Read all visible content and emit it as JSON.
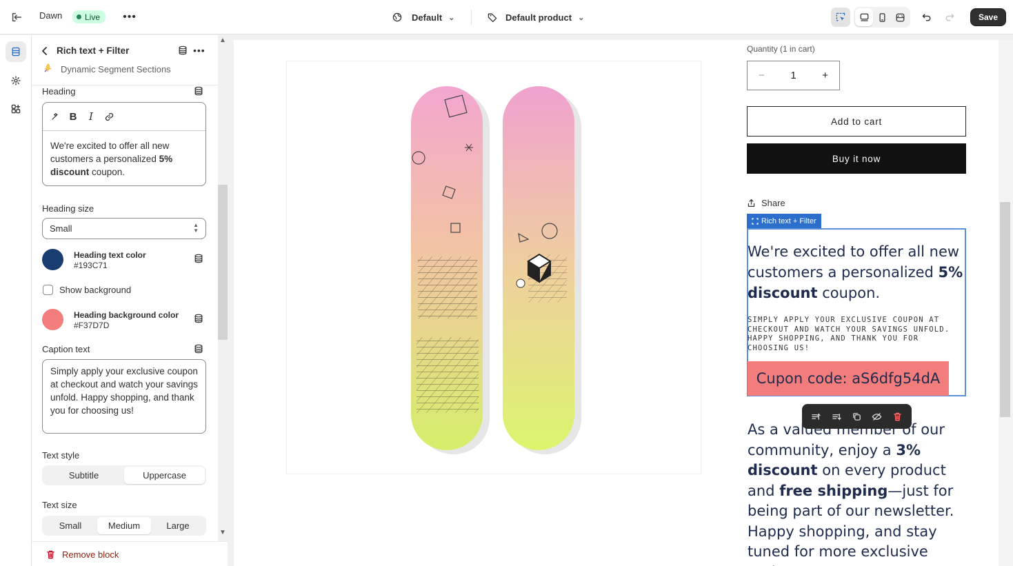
{
  "topbar": {
    "theme_name": "Dawn",
    "live_badge": "Live",
    "template_label": "Default",
    "product_label": "Default product",
    "save_label": "Save"
  },
  "panel": {
    "title": "Rich text + Filter",
    "subtitle": "Dynamic Segment Sections",
    "heading_label": "Heading",
    "heading_text_parts": [
      "We're excited to offer all new customers a personalized ",
      "5% discount",
      " coupon."
    ],
    "heading_size_label": "Heading size",
    "heading_size_value": "Small",
    "heading_text_color_label": "Heading text color",
    "heading_text_color_value": "#193C71",
    "show_background_label": "Show background",
    "heading_bg_color_label": "Heading background color",
    "heading_bg_color_value": "#F37D7D",
    "caption_label": "Caption text",
    "caption_value": "Simply apply your exclusive coupon at checkout and watch your savings unfold. Happy shopping, and thank you for choosing us!",
    "text_style_label": "Text style",
    "text_style_options": [
      "Subtitle",
      "Uppercase"
    ],
    "text_style_selected": "Uppercase",
    "text_size_label": "Text size",
    "text_size_options": [
      "Small",
      "Medium",
      "Large"
    ],
    "text_size_selected": "Medium",
    "remove_block_label": "Remove block"
  },
  "preview": {
    "quantity_label": "Quantity (1 in cart)",
    "quantity_value": "1",
    "minus_symbol": "−",
    "plus_symbol": "+",
    "add_to_cart": "Add to cart",
    "buy_now": "Buy it now",
    "share": "Share",
    "selection_tag": "Rich text + Filter",
    "rich_heading_parts": [
      "We're excited to offer all new customers a personalized ",
      "5% discount",
      " coupon."
    ],
    "rich_caption": "Simply apply your exclusive coupon at checkout and watch your savings unfold. Happy shopping, and thank you for choosing us!",
    "coupon_text": "Cupon code: aS6dfg54dA",
    "second_text_parts": [
      "As a valued member of our community, enjoy a ",
      "3% discount",
      " on every product and ",
      "free shipping",
      "—just for being part of our newsletter. Happy shopping, and stay tuned for more exclusive perks!"
    ]
  },
  "colors": {
    "heading_text_color": "#193C71",
    "heading_bg_color": "#F37D7D",
    "live_green": "#29845a",
    "selection_blue": "#2c6ecb"
  },
  "icons": {
    "exit": "exit-icon",
    "more": "more-horizontal-icon",
    "globe": "globe-icon",
    "tag": "tag-icon",
    "inspect": "inspector-icon",
    "desktop": "desktop-icon",
    "mobile": "mobile-icon",
    "fullwidth": "full-width-icon",
    "undo": "undo-icon",
    "redo": "redo-icon",
    "sections": "sections-icon",
    "settings": "gear-icon",
    "apps": "apps-icon",
    "database": "dynamic-source-icon",
    "trash": "trash-icon"
  }
}
